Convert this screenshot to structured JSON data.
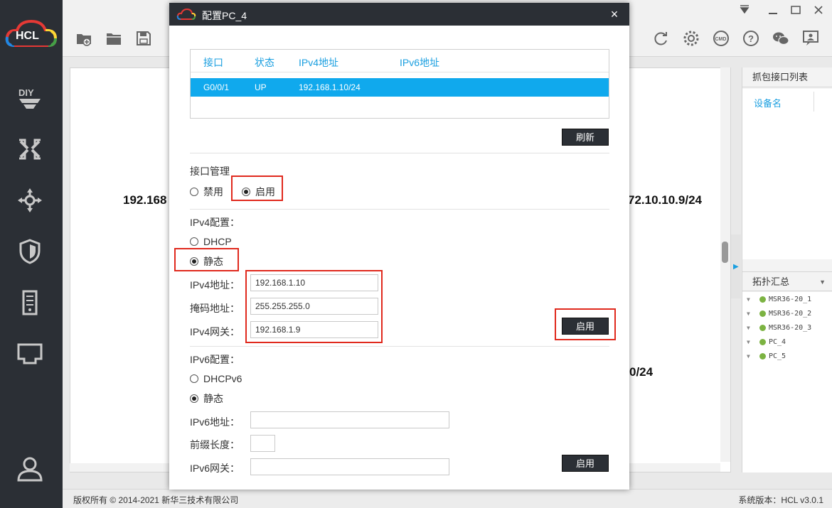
{
  "app": {
    "logo_text": "HCL",
    "status": {
      "copyright": "版权所有 © 2014-2021 新华三技术有限公司",
      "version": "系统版本：HCL v3.0.1"
    },
    "sidebar_icons": [
      "diy-icon",
      "network-switch-icon",
      "move-arrows-icon",
      "security-shield-icon",
      "server-icon",
      "ethernet-port-icon",
      "user-icon"
    ],
    "toolbar_icons": [
      "new-project-icon",
      "open-folder-icon",
      "save-icon",
      "refresh-icon",
      "settings-gear-icon",
      "cmd-icon",
      "help-icon",
      "wechat-icon",
      "feedback-icon"
    ]
  },
  "canvas": {
    "labels": [
      "192.168",
      "72.10.10.9/24",
      "0/24"
    ]
  },
  "right_panel": {
    "capture_title": "抓包接口列表",
    "capture_column": "设备名",
    "topology_title": "拓扑汇总",
    "devices": [
      "MSR36-20_1",
      "MSR36-20_2",
      "MSR36-20_3",
      "PC_4",
      "PC_5"
    ]
  },
  "dialog": {
    "title": "配置PC_4",
    "close": "×",
    "table": {
      "headers": [
        "接口",
        "状态",
        "IPv4地址",
        "IPv6地址"
      ],
      "rows": [
        {
          "iface": "G0/0/1",
          "state": "UP",
          "ipv4": "192.168.1.10/24",
          "ipv6": ""
        }
      ]
    },
    "refresh_label": "刷新",
    "iface_mgmt": {
      "label": "接口管理",
      "disable": "禁用",
      "enable": "启用",
      "selected": "enable"
    },
    "ipv4": {
      "section": "IPv4配置：",
      "dhcp": "DHCP",
      "static": "静态",
      "selected": "static",
      "addr_label": "IPv4地址：",
      "addr_value": "192.168.1.10",
      "mask_label": "掩码地址：",
      "mask_value": "255.255.255.0",
      "gw_label": "IPv4网关：",
      "gw_value": "192.168.1.9",
      "apply_label": "启用"
    },
    "ipv6": {
      "section": "IPv6配置：",
      "dhcp": "DHCPv6",
      "static": "静态",
      "selected": "static",
      "addr_label": "IPv6地址：",
      "addr_value": "",
      "prefix_label": "前缀长度：",
      "prefix_value": "",
      "gw_label": "IPv6网关：",
      "gw_value": "",
      "apply_label": "启用"
    }
  },
  "colors": {
    "accent": "#1a9fe0",
    "selected_row": "#10a9ed",
    "highlight_box": "#e0291d",
    "dark": "#2b2f35"
  }
}
